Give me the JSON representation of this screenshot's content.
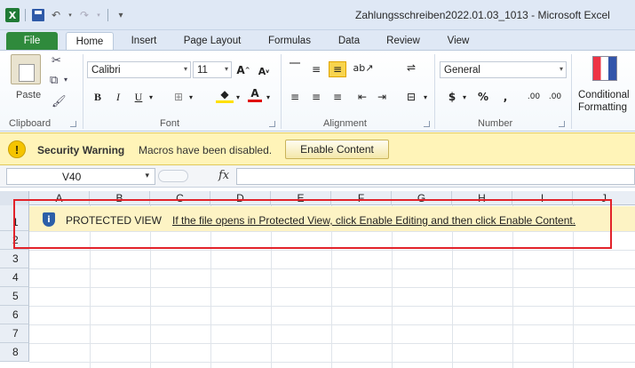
{
  "window": {
    "logo": "X",
    "title": "Zahlungsschreiben2022.01.03_1013  -  Microsoft Excel"
  },
  "ribbon_tabs": [
    "File",
    "Home",
    "Insert",
    "Page Layout",
    "Formulas",
    "Data",
    "Review",
    "View"
  ],
  "ribbon": {
    "clipboard": {
      "label": "Clipboard",
      "paste": "Paste"
    },
    "font": {
      "label": "Font",
      "name": "Calibri",
      "size": "11",
      "bold": "B",
      "italic": "I",
      "underline": "U"
    },
    "alignment": {
      "label": "Alignment"
    },
    "number": {
      "label": "Number",
      "format": "General",
      "currency": "$",
      "percent": "%",
      "comma": ",",
      "inc_decimal": ".00",
      "dec_decimal": ".00"
    },
    "styles": {
      "conditional_line1": "Conditional",
      "conditional_line2": "Formatting"
    }
  },
  "security_bar": {
    "title": "Security Warning",
    "message": "Macros have been disabled.",
    "button": "Enable Content"
  },
  "formula_bar": {
    "name_box": "V40",
    "fx": "fx",
    "value": ""
  },
  "grid": {
    "columns": [
      "A",
      "B",
      "C",
      "D",
      "E",
      "F",
      "G",
      "H",
      "I",
      "J"
    ],
    "rows": [
      "1",
      "2",
      "3",
      "4",
      "5",
      "6",
      "7",
      "8"
    ]
  },
  "protected_view": {
    "title": "PROTECTED VIEW",
    "message": "If the file opens in Protected View, click Enable Editing and then click Enable Content."
  },
  "colors": {
    "file_tab": "#2f8a3c",
    "warning_bar": "#fff4b8",
    "annotation_box": "#e2232a"
  }
}
